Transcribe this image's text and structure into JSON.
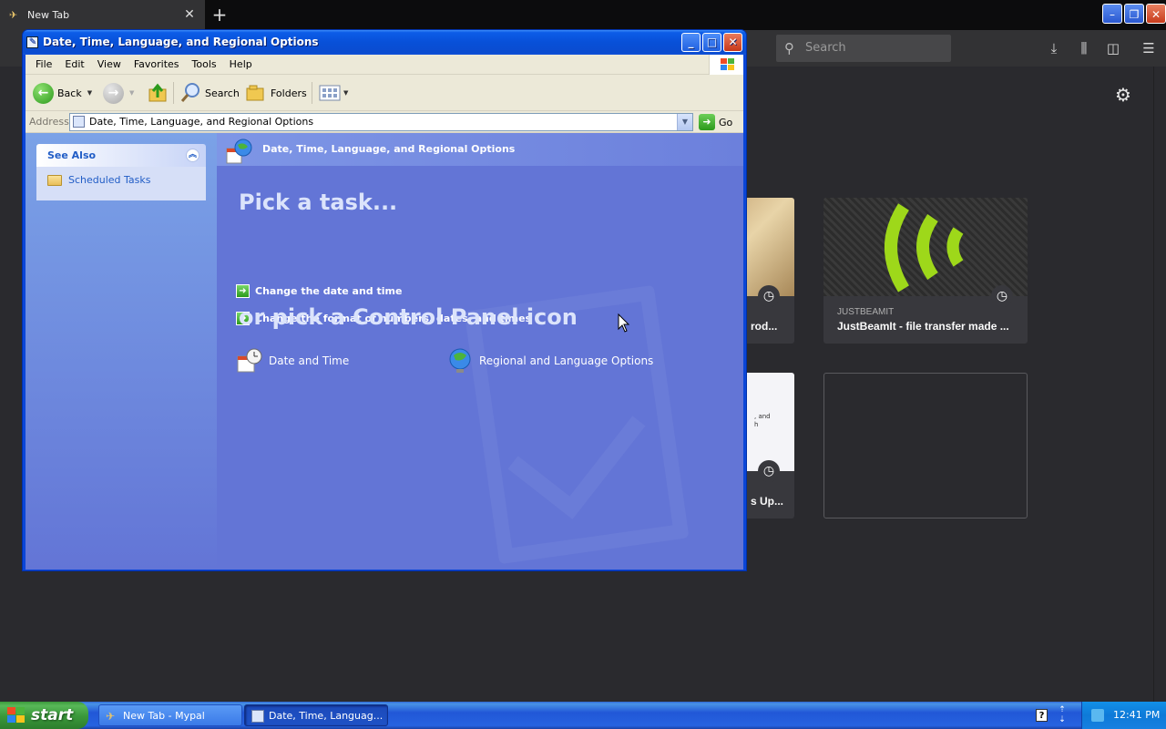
{
  "browser": {
    "tab_title": "New Tab",
    "search_placeholder": "Search",
    "tiles": [
      {
        "host": "",
        "title": "rod..."
      },
      {
        "host": "JUSTBEAMIT",
        "title": "JustBeamIt - file transfer made ..."
      },
      {
        "title": "s Up...",
        "snippet": ", and\nh"
      }
    ]
  },
  "window": {
    "title": "Date, Time, Language, and Regional Options",
    "menu": [
      "File",
      "Edit",
      "View",
      "Favorites",
      "Tools",
      "Help"
    ],
    "toolbar": {
      "back": "Back",
      "search": "Search",
      "folders": "Folders"
    },
    "address": {
      "label": "Address",
      "value": "Date, Time, Language, and Regional Options",
      "go": "Go"
    },
    "see_also": {
      "header": "See Also",
      "items": [
        "Scheduled Tasks"
      ]
    },
    "header_title": "Date, Time, Language, and Regional Options",
    "pick_task": "Pick a task...",
    "tasks": [
      "Change the date and time",
      "Change the format of numbers, dates, and times"
    ],
    "pick_icon": "or pick a Control Panel icon",
    "icons": [
      "Date and Time",
      "Regional and Language Options"
    ]
  },
  "taskbar": {
    "start": "start",
    "buttons": [
      "New Tab - Mypal",
      "Date, Time, Languag..."
    ],
    "clock": "12:41 PM"
  },
  "colors": {
    "xp_blue": "#0a46d8",
    "task_pane": "#6375d6",
    "start_green": "#3c9a3c"
  }
}
